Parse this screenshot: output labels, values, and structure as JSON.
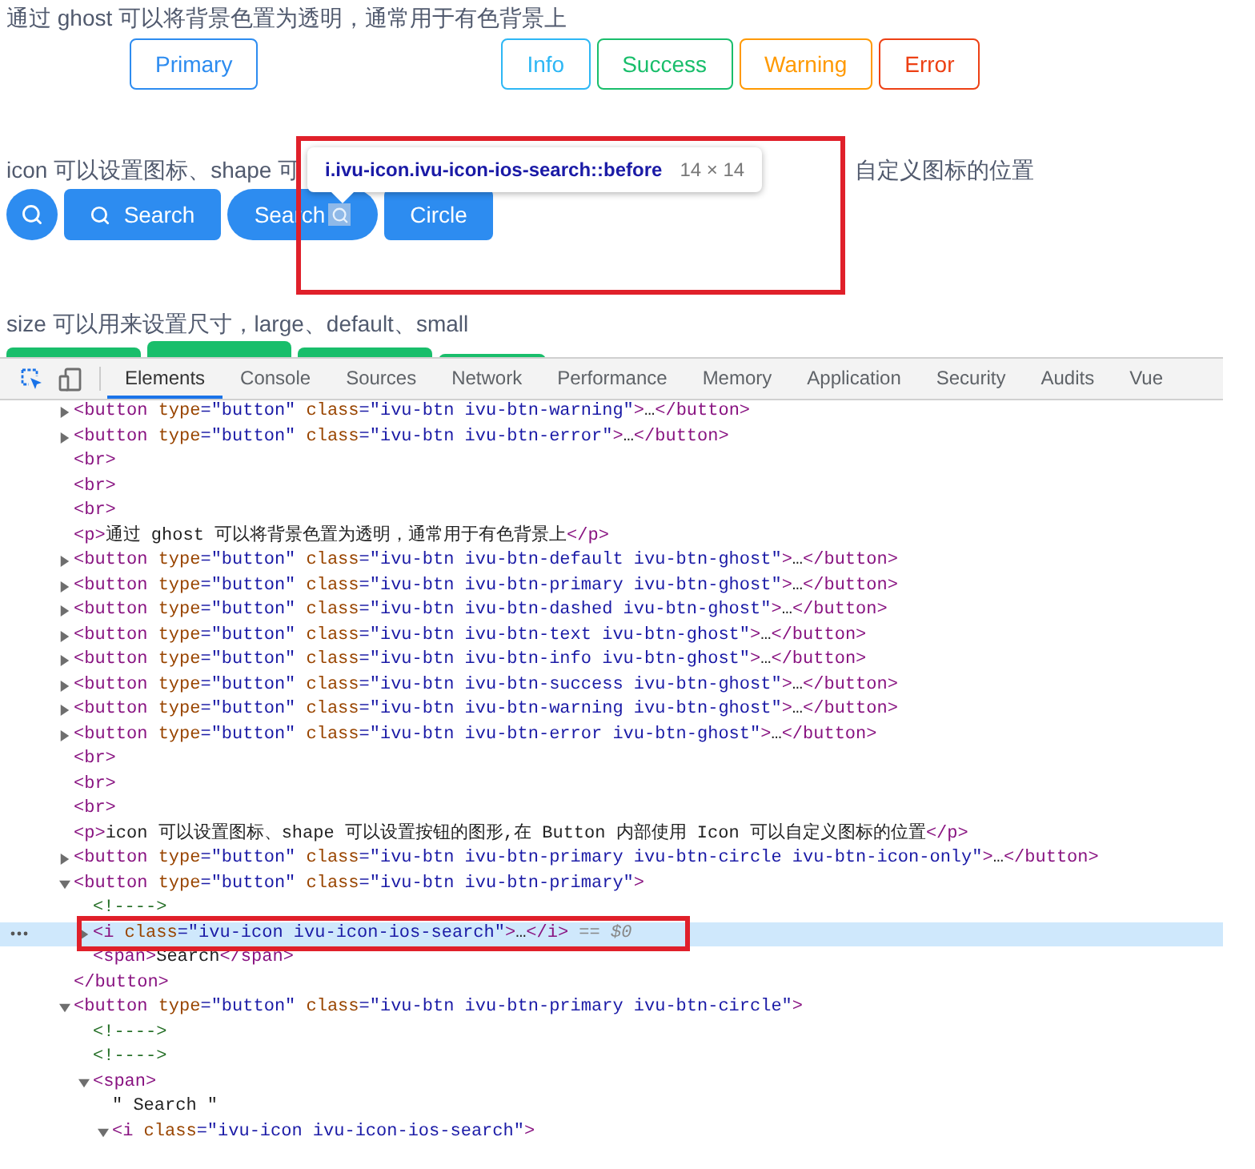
{
  "preview": {
    "ghost_text": "通过 ghost 可以将背景色置为透明，通常用于有色背景上",
    "ghost_buttons": [
      {
        "label": "Primary",
        "kind": "primary"
      },
      {
        "label": "Info",
        "kind": "info"
      },
      {
        "label": "Success",
        "kind": "success"
      },
      {
        "label": "Warning",
        "kind": "warning"
      },
      {
        "label": "Error",
        "kind": "error"
      }
    ],
    "icon_text_start": "icon 可以设置图标、shape 可",
    "icon_text_end": "自定义图标的位置",
    "icon_buttons": [
      {
        "kind": "icon-only"
      },
      {
        "kind": "icon-left",
        "label": "Search"
      },
      {
        "kind": "icon-right-round",
        "label": "Search"
      },
      {
        "kind": "plain",
        "label": "Circle"
      }
    ],
    "size_text": "size 可以用来设置尺寸，large、default、small",
    "size_buttons": [
      {
        "kind": "default"
      },
      {
        "kind": "large"
      },
      {
        "kind": "default"
      },
      {
        "kind": "small"
      }
    ]
  },
  "tooltip": {
    "selector": "i.ivu-icon.ivu-icon-ios-search::before",
    "size": "14 × 14"
  },
  "devtools": {
    "tabs": [
      {
        "label": "Elements",
        "selected": true
      },
      {
        "label": "Console",
        "selected": false
      },
      {
        "label": "Sources",
        "selected": false
      },
      {
        "label": "Network",
        "selected": false
      },
      {
        "label": "Performance",
        "selected": false
      },
      {
        "label": "Memory",
        "selected": false
      },
      {
        "label": "Application",
        "selected": false
      },
      {
        "label": "Security",
        "selected": false
      },
      {
        "label": "Audits",
        "selected": false
      },
      {
        "label": "Vue",
        "selected": false
      }
    ],
    "dom_tree": [
      {
        "kind": "element",
        "expanded": false,
        "selected": false,
        "segments": [
          {
            "kind": "tag",
            "text": "<button"
          },
          {
            "kind": "attr",
            "text": " type"
          },
          {
            "kind": "value",
            "text": "=\"button\""
          },
          {
            "kind": "attr",
            "text": " class"
          },
          {
            "kind": "value",
            "text": "=\"ivu-btn ivu-btn-warning\""
          },
          {
            "kind": "tag",
            "text": ">"
          },
          {
            "kind": "text",
            "text": "…"
          },
          {
            "kind": "tag",
            "text": "</button>"
          }
        ]
      },
      {
        "kind": "element",
        "expanded": false,
        "selected": false,
        "segments": [
          {
            "kind": "tag",
            "text": "<button"
          },
          {
            "kind": "attr",
            "text": " type"
          },
          {
            "kind": "value",
            "text": "=\"button\""
          },
          {
            "kind": "attr",
            "text": " class"
          },
          {
            "kind": "value",
            "text": "=\"ivu-btn ivu-btn-error\""
          },
          {
            "kind": "tag",
            "text": ">"
          },
          {
            "kind": "text",
            "text": "…"
          },
          {
            "kind": "tag",
            "text": "</button>"
          }
        ]
      },
      {
        "kind": "leaf",
        "selected": false,
        "segments": [
          {
            "kind": "tag",
            "text": "<br>"
          }
        ]
      },
      {
        "kind": "leaf",
        "selected": false,
        "segments": [
          {
            "kind": "tag",
            "text": "<br>"
          }
        ]
      },
      {
        "kind": "leaf",
        "selected": false,
        "segments": [
          {
            "kind": "tag",
            "text": "<br>"
          }
        ]
      },
      {
        "kind": "leaf",
        "selected": false,
        "segments": [
          {
            "kind": "tag",
            "text": "<p>"
          },
          {
            "kind": "text",
            "text": "通过 ghost 可以将背景色置为透明，通常用于有色背景上"
          },
          {
            "kind": "tag",
            "text": "</p>"
          }
        ]
      },
      {
        "kind": "element",
        "expanded": false,
        "selected": false,
        "segments": [
          {
            "kind": "tag",
            "text": "<button"
          },
          {
            "kind": "attr",
            "text": " type"
          },
          {
            "kind": "value",
            "text": "=\"button\""
          },
          {
            "kind": "attr",
            "text": " class"
          },
          {
            "kind": "value",
            "text": "=\"ivu-btn ivu-btn-default ivu-btn-ghost\""
          },
          {
            "kind": "tag",
            "text": ">"
          },
          {
            "kind": "text",
            "text": "…"
          },
          {
            "kind": "tag",
            "text": "</button>"
          }
        ]
      },
      {
        "kind": "element",
        "expanded": false,
        "selected": false,
        "segments": [
          {
            "kind": "tag",
            "text": "<button"
          },
          {
            "kind": "attr",
            "text": " type"
          },
          {
            "kind": "value",
            "text": "=\"button\""
          },
          {
            "kind": "attr",
            "text": " class"
          },
          {
            "kind": "value",
            "text": "=\"ivu-btn ivu-btn-primary ivu-btn-ghost\""
          },
          {
            "kind": "tag",
            "text": ">"
          },
          {
            "kind": "text",
            "text": "…"
          },
          {
            "kind": "tag",
            "text": "</button>"
          }
        ]
      },
      {
        "kind": "element",
        "expanded": false,
        "selected": false,
        "segments": [
          {
            "kind": "tag",
            "text": "<button"
          },
          {
            "kind": "attr",
            "text": " type"
          },
          {
            "kind": "value",
            "text": "=\"button\""
          },
          {
            "kind": "attr",
            "text": " class"
          },
          {
            "kind": "value",
            "text": "=\"ivu-btn ivu-btn-dashed ivu-btn-ghost\""
          },
          {
            "kind": "tag",
            "text": ">"
          },
          {
            "kind": "text",
            "text": "…"
          },
          {
            "kind": "tag",
            "text": "</button>"
          }
        ]
      },
      {
        "kind": "element",
        "expanded": false,
        "selected": false,
        "segments": [
          {
            "kind": "tag",
            "text": "<button"
          },
          {
            "kind": "attr",
            "text": " type"
          },
          {
            "kind": "value",
            "text": "=\"button\""
          },
          {
            "kind": "attr",
            "text": " class"
          },
          {
            "kind": "value",
            "text": "=\"ivu-btn ivu-btn-text ivu-btn-ghost\""
          },
          {
            "kind": "tag",
            "text": ">"
          },
          {
            "kind": "text",
            "text": "…"
          },
          {
            "kind": "tag",
            "text": "</button>"
          }
        ]
      },
      {
        "kind": "element",
        "expanded": false,
        "selected": false,
        "segments": [
          {
            "kind": "tag",
            "text": "<button"
          },
          {
            "kind": "attr",
            "text": " type"
          },
          {
            "kind": "value",
            "text": "=\"button\""
          },
          {
            "kind": "attr",
            "text": " class"
          },
          {
            "kind": "value",
            "text": "=\"ivu-btn ivu-btn-info ivu-btn-ghost\""
          },
          {
            "kind": "tag",
            "text": ">"
          },
          {
            "kind": "text",
            "text": "…"
          },
          {
            "kind": "tag",
            "text": "</button>"
          }
        ]
      },
      {
        "kind": "element",
        "expanded": false,
        "selected": false,
        "segments": [
          {
            "kind": "tag",
            "text": "<button"
          },
          {
            "kind": "attr",
            "text": " type"
          },
          {
            "kind": "value",
            "text": "=\"button\""
          },
          {
            "kind": "attr",
            "text": " class"
          },
          {
            "kind": "value",
            "text": "=\"ivu-btn ivu-btn-success ivu-btn-ghost\""
          },
          {
            "kind": "tag",
            "text": ">"
          },
          {
            "kind": "text",
            "text": "…"
          },
          {
            "kind": "tag",
            "text": "</button>"
          }
        ]
      },
      {
        "kind": "element",
        "expanded": false,
        "selected": false,
        "segments": [
          {
            "kind": "tag",
            "text": "<button"
          },
          {
            "kind": "attr",
            "text": " type"
          },
          {
            "kind": "value",
            "text": "=\"button\""
          },
          {
            "kind": "attr",
            "text": " class"
          },
          {
            "kind": "value",
            "text": "=\"ivu-btn ivu-btn-warning ivu-btn-ghost\""
          },
          {
            "kind": "tag",
            "text": ">"
          },
          {
            "kind": "text",
            "text": "…"
          },
          {
            "kind": "tag",
            "text": "</button>"
          }
        ]
      },
      {
        "kind": "element",
        "expanded": false,
        "selected": false,
        "segments": [
          {
            "kind": "tag",
            "text": "<button"
          },
          {
            "kind": "attr",
            "text": " type"
          },
          {
            "kind": "value",
            "text": "=\"button\""
          },
          {
            "kind": "attr",
            "text": " class"
          },
          {
            "kind": "value",
            "text": "=\"ivu-btn ivu-btn-error ivu-btn-ghost\""
          },
          {
            "kind": "tag",
            "text": ">"
          },
          {
            "kind": "text",
            "text": "…"
          },
          {
            "kind": "tag",
            "text": "</button>"
          }
        ]
      },
      {
        "kind": "leaf",
        "selected": false,
        "segments": [
          {
            "kind": "tag",
            "text": "<br>"
          }
        ]
      },
      {
        "kind": "leaf",
        "selected": false,
        "segments": [
          {
            "kind": "tag",
            "text": "<br>"
          }
        ]
      },
      {
        "kind": "leaf",
        "selected": false,
        "segments": [
          {
            "kind": "tag",
            "text": "<br>"
          }
        ]
      },
      {
        "kind": "leaf",
        "selected": false,
        "segments": [
          {
            "kind": "tag",
            "text": "<p>"
          },
          {
            "kind": "text",
            "text": "icon 可以设置图标、shape 可以设置按钮的图形,在 Button 内部使用 Icon 可以自定义图标的位置"
          },
          {
            "kind": "tag",
            "text": "</p>"
          }
        ]
      },
      {
        "kind": "element",
        "expanded": false,
        "selected": false,
        "segments": [
          {
            "kind": "tag",
            "text": "<button"
          },
          {
            "kind": "attr",
            "text": " type"
          },
          {
            "kind": "value",
            "text": "=\"button\""
          },
          {
            "kind": "attr",
            "text": " class"
          },
          {
            "kind": "value",
            "text": "=\"ivu-btn ivu-btn-primary ivu-btn-circle ivu-btn-icon-only\""
          },
          {
            "kind": "tag",
            "text": ">"
          },
          {
            "kind": "text",
            "text": "…"
          },
          {
            "kind": "tag",
            "text": "</button>"
          }
        ]
      },
      {
        "kind": "element",
        "expanded": true,
        "selected": false,
        "segments": [
          {
            "kind": "tag",
            "text": "<button"
          },
          {
            "kind": "attr",
            "text": " type"
          },
          {
            "kind": "value",
            "text": "=\"button\""
          },
          {
            "kind": "attr",
            "text": " class"
          },
          {
            "kind": "value",
            "text": "=\"ivu-btn ivu-btn-primary\""
          },
          {
            "kind": "tag",
            "text": ">"
          }
        ],
        "children": [
          {
            "kind": "leaf",
            "selected": false,
            "segments": [
              {
                "kind": "comment",
                "text": "<!---->"
              }
            ]
          },
          {
            "kind": "element",
            "expanded": false,
            "selected": true,
            "segments": [
              {
                "kind": "tag",
                "text": "<i"
              },
              {
                "kind": "attr",
                "text": " class"
              },
              {
                "kind": "value",
                "text": "=\"ivu-icon ivu-icon-ios-search\""
              },
              {
                "kind": "tag",
                "text": ">"
              },
              {
                "kind": "text",
                "text": "…"
              },
              {
                "kind": "tag",
                "text": "</i>"
              },
              {
                "kind": "marker",
                "text": " == $0"
              }
            ]
          },
          {
            "kind": "leaf",
            "selected": false,
            "segments": [
              {
                "kind": "tag",
                "text": "<span>"
              },
              {
                "kind": "text",
                "text": "Search"
              },
              {
                "kind": "tag",
                "text": "</span>"
              }
            ]
          }
        ],
        "closing": [
          {
            "kind": "tag",
            "text": "</button>"
          }
        ]
      },
      {
        "kind": "element",
        "expanded": true,
        "selected": false,
        "segments": [
          {
            "kind": "tag",
            "text": "<button"
          },
          {
            "kind": "attr",
            "text": " type"
          },
          {
            "kind": "value",
            "text": "=\"button\""
          },
          {
            "kind": "attr",
            "text": " class"
          },
          {
            "kind": "value",
            "text": "=\"ivu-btn ivu-btn-primary ivu-btn-circle\""
          },
          {
            "kind": "tag",
            "text": ">"
          }
        ],
        "children": [
          {
            "kind": "leaf",
            "selected": false,
            "segments": [
              {
                "kind": "comment",
                "text": "<!---->"
              }
            ]
          },
          {
            "kind": "leaf",
            "selected": false,
            "segments": [
              {
                "kind": "comment",
                "text": "<!---->"
              }
            ]
          },
          {
            "kind": "element",
            "expanded": true,
            "selected": false,
            "segments": [
              {
                "kind": "tag",
                "text": "<span>"
              }
            ],
            "children": [
              {
                "kind": "leaf",
                "selected": false,
                "segments": [
                  {
                    "kind": "text",
                    "text": "\" Search \""
                  }
                ]
              },
              {
                "kind": "element",
                "expanded": true,
                "selected": false,
                "segments": [
                  {
                    "kind": "tag",
                    "text": "<i"
                  },
                  {
                    "kind": "attr",
                    "text": " class"
                  },
                  {
                    "kind": "value",
                    "text": "=\"ivu-icon ivu-icon-ios-search\""
                  },
                  {
                    "kind": "tag",
                    "text": ">"
                  }
                ]
              }
            ]
          }
        ]
      }
    ]
  }
}
